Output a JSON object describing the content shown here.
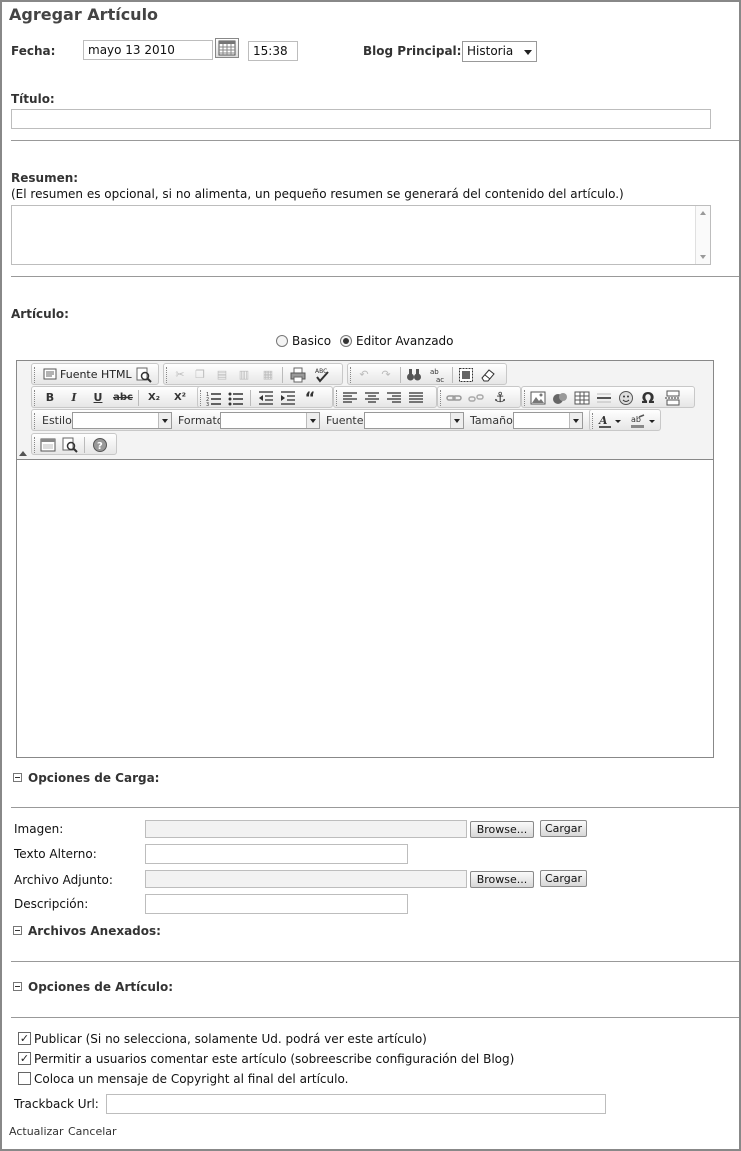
{
  "page_title": "Agregar Artículo",
  "fecha": {
    "label": "Fecha:",
    "date_value": "mayo       13 2010",
    "time_value": "15:38"
  },
  "blog": {
    "label": "Blog Principal:",
    "selected": "Historia"
  },
  "titulo": {
    "label": "Título:",
    "value": ""
  },
  "resumen": {
    "label": "Resumen:",
    "hint": "(El resumen es opcional, si no alimenta, un pequeño resumen se generará del contenido del artículo.)",
    "value": ""
  },
  "articulo": {
    "label": "Artículo:",
    "mode_basic": "Basico",
    "mode_advanced": "Editor Avanzado",
    "selected_mode": "Editor Avanzado"
  },
  "editor": {
    "source_label": "Fuente HTML",
    "estilo_label": "Estilo",
    "formato_label": "Formato",
    "fuente_label": "Fuente",
    "tamano_label": "Tamaño",
    "bold": "B",
    "italic": "I",
    "underline": "U",
    "strike": "abc",
    "subscript": "X₂",
    "superscript": "X²",
    "omega": "Ω"
  },
  "carga": {
    "header": "Opciones de Carga:",
    "imagen_label": "Imagen:",
    "texto_alterno_label": "Texto Alterno:",
    "archivo_label": "Archivo Adjunto:",
    "descripcion_label": "Descripción:",
    "browse_label": "Browse...",
    "cargar_label": "Cargar"
  },
  "anexados": {
    "header": "Archivos Anexados:"
  },
  "opciones": {
    "header": "Opciones de Artículo:",
    "publicar": "Publicar (Si no selecciona, solamente Ud. podrá ver este artículo)",
    "publicar_checked": true,
    "comentar": "Permitir a usuarios comentar este artículo (sobreescribe configuración del Blog)",
    "comentar_checked": true,
    "copyright": "Coloca un mensaje de Copyright al final del artículo.",
    "copyright_checked": false,
    "trackback_label": "Trackback Url:",
    "trackback_value": ""
  },
  "actions": {
    "update": "Actualizar",
    "cancel": "Cancelar"
  }
}
